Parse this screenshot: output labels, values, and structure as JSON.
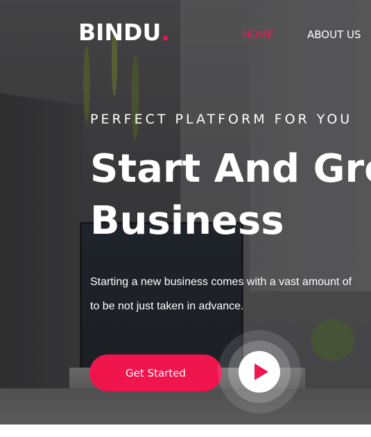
{
  "header": {
    "logo_text": "BINDU",
    "logo_dot": ".",
    "nav": [
      {
        "label": "HOME",
        "active": true
      },
      {
        "label": "ABOUT US",
        "active": false
      }
    ]
  },
  "hero": {
    "tagline": "PERFECT PLATFORM FOR YOU",
    "headline_line1": "Start And Grow Your",
    "headline_line2": "Business",
    "description_line1": "Starting a new business comes with a vast amount of",
    "description_line2": "to be not just taken in advance.",
    "cta_label": "Get Started",
    "play_icon": "play-icon"
  },
  "colors": {
    "accent": "#f0154d",
    "text": "#ffffff"
  }
}
